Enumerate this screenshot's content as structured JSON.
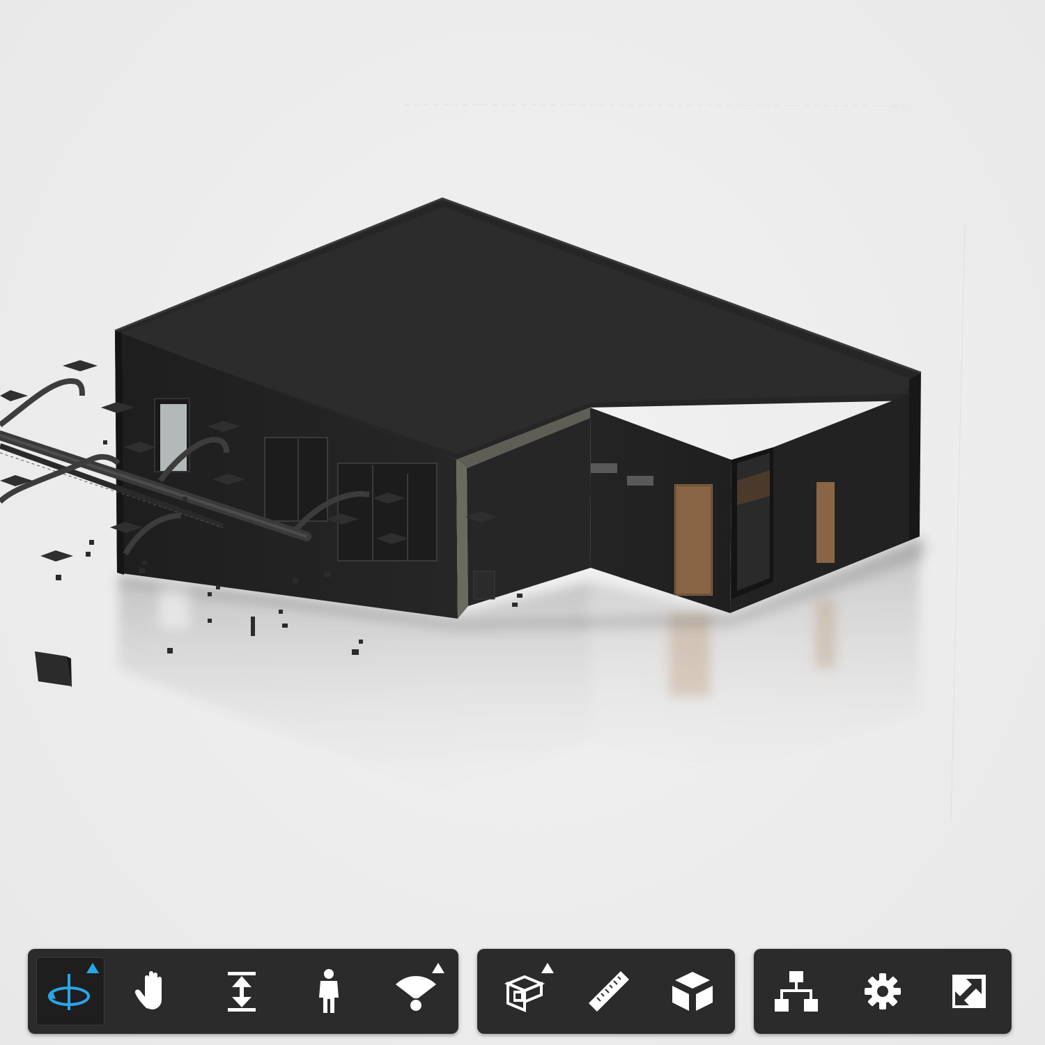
{
  "viewer": {
    "background_color": "#ececec",
    "model_color": "#232323",
    "accent_color": "#2aa5e8"
  },
  "toolbar": {
    "navigation_tools": [
      {
        "name": "orbit",
        "icon": "orbit-icon",
        "active": true,
        "has_flyout": true
      },
      {
        "name": "pan",
        "icon": "hand-icon",
        "active": false,
        "has_flyout": false
      },
      {
        "name": "zoom",
        "icon": "zoom-arrows-icon",
        "active": false,
        "has_flyout": false
      },
      {
        "name": "first-person",
        "icon": "person-icon",
        "active": false,
        "has_flyout": false
      },
      {
        "name": "camera",
        "icon": "camera-interactions-icon",
        "active": false,
        "has_flyout": true
      }
    ],
    "model_tools": [
      {
        "name": "section",
        "icon": "section-analysis-icon",
        "active": false,
        "has_flyout": true
      },
      {
        "name": "measure",
        "icon": "ruler-icon",
        "active": false,
        "has_flyout": false
      },
      {
        "name": "explode",
        "icon": "explode-cube-icon",
        "active": false,
        "has_flyout": false
      }
    ],
    "settings_tools": [
      {
        "name": "model-browser",
        "icon": "structure-tree-icon",
        "active": false,
        "has_flyout": false
      },
      {
        "name": "settings",
        "icon": "gear-icon",
        "active": false,
        "has_flyout": false
      },
      {
        "name": "full-screen",
        "icon": "fullscreen-icon",
        "active": false,
        "has_flyout": false
      }
    ]
  }
}
